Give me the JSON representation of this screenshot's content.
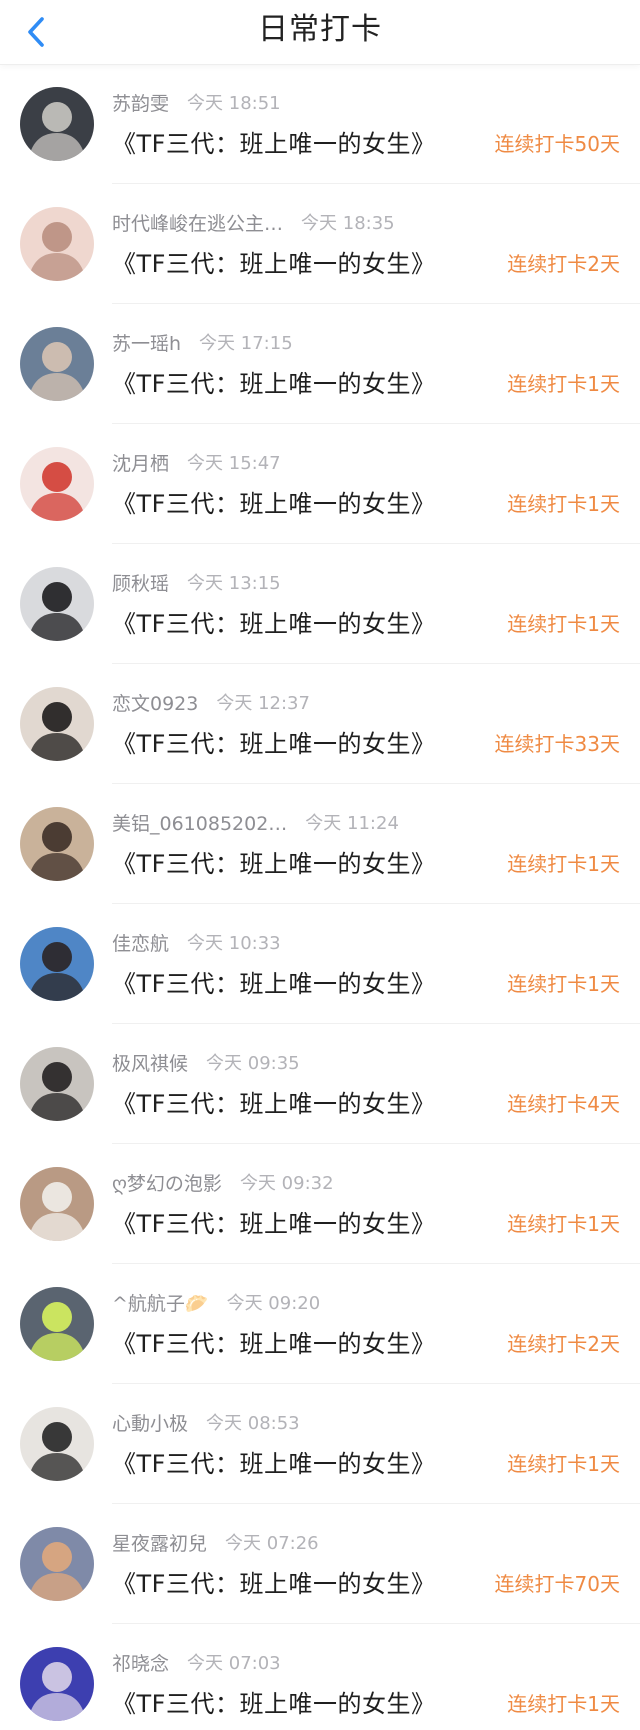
{
  "header": {
    "title": "日常打卡",
    "back_icon": "chevron-left-icon",
    "accent": "#2f8cf5"
  },
  "colors": {
    "streak": "#ef8a43",
    "username": "#8e8e93",
    "time": "#b3b3b8"
  },
  "entries": [
    {
      "user": "苏韵雯",
      "time": "今天 18:51",
      "book": "《TF三代：班上唯一的女生》",
      "streak": "连续打卡50天",
      "avatar": {
        "bg": "#3b3f46",
        "fg": "#c9c6c1"
      }
    },
    {
      "user": "时代峰峻在逃公主…",
      "time": "今天 18:35",
      "book": "《TF三代：班上唯一的女生》",
      "streak": "连续打卡2天",
      "avatar": {
        "bg": "#efd7cf",
        "fg": "#b98f80"
      }
    },
    {
      "user": "苏一瑶h",
      "time": "今天 17:15",
      "book": "《TF三代：班上唯一的女生》",
      "streak": "连续打卡1天",
      "avatar": {
        "bg": "#6b7f97",
        "fg": "#d7c3b2"
      }
    },
    {
      "user": "沈月栖",
      "time": "今天 15:47",
      "book": "《TF三代：班上唯一的女生》",
      "streak": "连续打卡1天",
      "avatar": {
        "bg": "#f3e4e1",
        "fg": "#d23c33"
      }
    },
    {
      "user": "顾秋瑶",
      "time": "今天 13:15",
      "book": "《TF三代：班上唯一的女生》",
      "streak": "连续打卡1天",
      "avatar": {
        "bg": "#d9dadd",
        "fg": "#1c1c1f"
      }
    },
    {
      "user": "恋文0923",
      "time": "今天 12:37",
      "book": "《TF三代：班上唯一的女生》",
      "streak": "连续打卡33天",
      "avatar": {
        "bg": "#e1d8d0",
        "fg": "#1e1c1b"
      }
    },
    {
      "user": "美铝_061085202…",
      "time": "今天 11:24",
      "book": "《TF三代：班上唯一的女生》",
      "streak": "连续打卡1天",
      "avatar": {
        "bg": "#c9b29a",
        "fg": "#3d2f28"
      }
    },
    {
      "user": "佳恋航",
      "time": "今天 10:33",
      "book": "《TF三代：班上唯一的女生》",
      "streak": "连续打卡1天",
      "avatar": {
        "bg": "#4f86c6",
        "fg": "#2a2424"
      }
    },
    {
      "user": "极风祺候",
      "time": "今天 09:35",
      "book": "《TF三代：班上唯一的女生》",
      "streak": "连续打卡4天",
      "avatar": {
        "bg": "#c8c4bf",
        "fg": "#232121"
      }
    },
    {
      "user": "ღ梦幻の泡影",
      "time": "今天 09:32",
      "book": "《TF三代：班上唯一的女生》",
      "streak": "连续打卡1天",
      "avatar": {
        "bg": "#b99a84",
        "fg": "#f1eeea"
      }
    },
    {
      "user": "^航航子🥟",
      "time": "今天 09:20",
      "book": "《TF三代：班上唯一的女生》",
      "streak": "连续打卡2天",
      "avatar": {
        "bg": "#5a6470",
        "fg": "#d7f25e"
      }
    },
    {
      "user": "心動小极",
      "time": "今天 08:53",
      "book": "《TF三代：班上唯一的女生》",
      "streak": "连续打卡1天",
      "avatar": {
        "bg": "#e7e4e0",
        "fg": "#252526"
      }
    },
    {
      "user": "星夜露初兒",
      "time": "今天 07:26",
      "book": "《TF三代：班上唯一的女生》",
      "streak": "连续打卡70天",
      "avatar": {
        "bg": "#7f8aa8",
        "fg": "#e0a77c"
      }
    },
    {
      "user": "祁晓念",
      "time": "今天 07:03",
      "book": "《TF三代：班上唯一的女生》",
      "streak": "连续打卡1天",
      "avatar": {
        "bg": "#3d3fb0",
        "fg": "#d9d2e8"
      }
    }
  ]
}
